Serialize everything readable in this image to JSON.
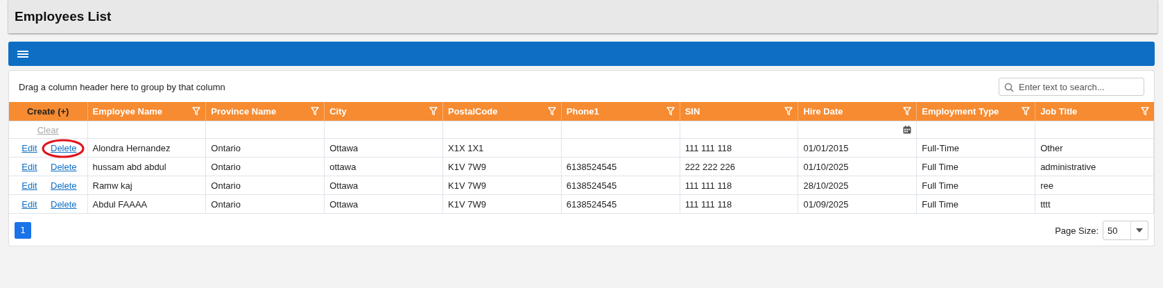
{
  "page_title": "Employees List",
  "grid": {
    "group_panel": "Drag a column header here to group by that column",
    "search": {
      "placeholder": "Enter text to search..."
    },
    "command_column": {
      "header": "Create (+)",
      "clear": "Clear"
    },
    "columns": [
      {
        "label": "Employee Name",
        "kind": "text"
      },
      {
        "label": "Province Name",
        "kind": "text"
      },
      {
        "label": "City",
        "kind": "text"
      },
      {
        "label": "PostalCode",
        "kind": "text"
      },
      {
        "label": "Phone1",
        "kind": "text"
      },
      {
        "label": "SIN",
        "kind": "text"
      },
      {
        "label": "Hire Date",
        "kind": "date"
      },
      {
        "label": "Employment Type",
        "kind": "text"
      },
      {
        "label": "Job Title",
        "kind": "text"
      }
    ],
    "rows": [
      {
        "edit": "Edit",
        "delete": "Delete",
        "delete_circled": true,
        "cells": [
          "Alondra Hernandez",
          "Ontario",
          "Ottawa",
          "X1X 1X1",
          "",
          "111 111 118",
          "01/01/2015",
          "Full-Time",
          "Other"
        ]
      },
      {
        "edit": "Edit",
        "delete": "Delete",
        "delete_circled": false,
        "cells": [
          "hussam abd abdul",
          "Ontario",
          "ottawa",
          "K1V 7W9",
          "6138524545",
          "222 222 226",
          "01/10/2025",
          "Full Time",
          "administrative"
        ]
      },
      {
        "edit": "Edit",
        "delete": "Delete",
        "delete_circled": false,
        "cells": [
          "Ramw kaj",
          "Ontario",
          "Ottawa",
          "K1V 7W9",
          "6138524545",
          "111 111 118",
          "28/10/2025",
          "Full Time",
          "ree"
        ]
      },
      {
        "edit": "Edit",
        "delete": "Delete",
        "delete_circled": false,
        "cells": [
          "Abdul FAAAA",
          "Ontario",
          "Ottawa",
          "K1V 7W9",
          "6138524545",
          "111 111 118",
          "01/09/2025",
          "Full Time",
          "tttt"
        ]
      }
    ],
    "pager": {
      "pages": [
        {
          "label": "1",
          "selected": true
        }
      ],
      "page_size_label": "Page Size:",
      "page_size": "50"
    }
  }
}
